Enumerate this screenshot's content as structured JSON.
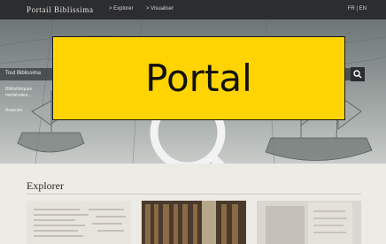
{
  "nav": {
    "brand": "Portail Biblissima",
    "links": [
      "> Explorer",
      "> Visualiser"
    ],
    "lang": "FR | EN"
  },
  "hero": {
    "search_label": "Tout Biblissima",
    "description": "Bibliothèques médiévales...",
    "link": "Avancée"
  },
  "overlay": {
    "title": "Portal"
  },
  "explorer": {
    "title": "Explorer"
  },
  "colors": {
    "overlay": "#ffd400",
    "navbar": "#2b2d31",
    "page_bg": "#ecebe6"
  }
}
